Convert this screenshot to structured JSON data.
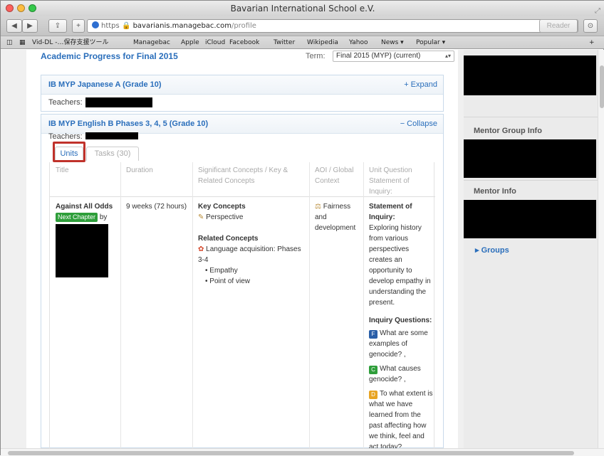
{
  "window": {
    "title": "Bavarian International School e.V."
  },
  "toolbar": {
    "back": "◀",
    "forward": "▶",
    "share": "⇪",
    "new_tab": "+",
    "url_scheme": "https",
    "url_host": "bavarianis.managebac.com",
    "url_path": "/profile",
    "reload": "↻",
    "reader": "Reader",
    "download": "⊙"
  },
  "bookmarks": [
    "Vid-DL -…保存支援ツール",
    "Managebac",
    "Apple",
    "iCloud",
    "Facebook",
    "Twitter",
    "Wikipedia",
    "Yahoo",
    "News ▾",
    "Popular ▾"
  ],
  "page": {
    "heading": "Academic Progress for Final 2015",
    "term_label": "Term:",
    "term_value": "Final 2015 (MYP) (current)"
  },
  "courses": [
    {
      "title": "IB MYP Japanese A (Grade 10)",
      "action": "+ Expand",
      "teachers_label": "Teachers:"
    },
    {
      "title": "IB MYP English B Phases 3, 4, 5 (Grade 10)",
      "action": "− Collapse",
      "teachers_label": "Teachers:"
    }
  ],
  "tabs": {
    "units": "Units",
    "tasks": "Tasks (30)"
  },
  "table": {
    "headers": [
      "Title",
      "Duration",
      "Significant Concepts / Key & Related Concepts",
      "AOI / Global Context",
      "Unit Question Statement of Inquiry:"
    ],
    "unit_title": "Against All Odds",
    "next_chapter": "Next Chapter",
    "by": "by",
    "duration": "9 weeks (72 hours)",
    "key_concepts_label": "Key Concepts",
    "key_concept": "Perspective",
    "related_concepts_label": "Related Concepts",
    "related_concept": "Language acquisition: Phases 3-4",
    "bullets": [
      "Empathy",
      "Point of view"
    ],
    "global_context": "Fairness and development",
    "soi_label": "Statement of Inquiry:",
    "soi_text": "Exploring history from various perspectives creates an opportunity to develop empathy in understanding the present.",
    "inquiry_label": "Inquiry Questions:",
    "questions": [
      {
        "tag": "F",
        "color": "#2a5fa8",
        "text": "What are some examples of genocide? ,"
      },
      {
        "tag": "C",
        "color": "#2e9e3a",
        "text": "What causes genocide? ,"
      },
      {
        "tag": "D",
        "color": "#e8a423",
        "text": "To what extent is what we have learned from the past affecting how we think, feel and act today?"
      }
    ]
  },
  "sidebar": {
    "mentor_group": "Mentor Group Info",
    "mentor": "Mentor Info",
    "groups": "▸  Groups"
  },
  "colors": {
    "link": "#2a6ebb",
    "highlight": "#c0322b",
    "badge_green": "#2e9e3a"
  }
}
